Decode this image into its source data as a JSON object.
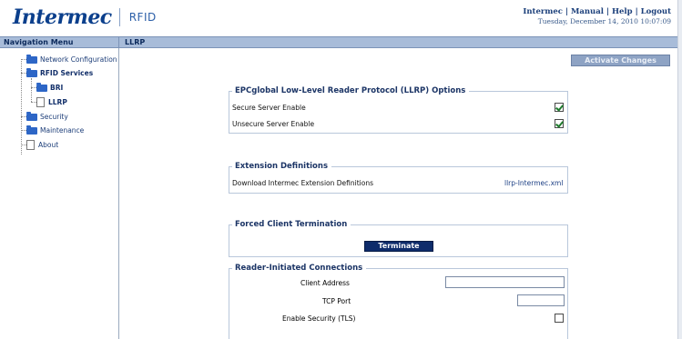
{
  "header": {
    "brand": "Intermec",
    "product": "RFID",
    "links": [
      "Intermec",
      "Manual",
      "Help",
      "Logout"
    ],
    "link_separator": " | ",
    "datetime": "Tuesday, December 14, 2010 10:07:09"
  },
  "nav": {
    "title": "Navigation Menu",
    "items": [
      {
        "label": "Network Configuration",
        "icon": "folder-icon"
      },
      {
        "label": "RFID Services",
        "icon": "folder-icon"
      },
      {
        "label": "BRI",
        "icon": "folder-icon"
      },
      {
        "label": "LLRP",
        "icon": "page-icon"
      },
      {
        "label": "Security",
        "icon": "folder-icon"
      },
      {
        "label": "Maintenance",
        "icon": "folder-icon"
      },
      {
        "label": "About",
        "icon": "page-icon"
      }
    ]
  },
  "page": {
    "title": "LLRP",
    "activate_label": "Activate Changes"
  },
  "llrp_options": {
    "legend": "EPCglobal Low-Level Reader Protocol (LLRP) Options",
    "secure_label": "Secure Server Enable",
    "secure_checked": true,
    "unsecure_label": "Unsecure Server Enable",
    "unsecure_checked": true
  },
  "extensions": {
    "legend": "Extension Definitions",
    "download_label": "Download Intermec Extension Definitions",
    "file_link": "llrp-Intermec.xml"
  },
  "forced": {
    "legend": "Forced Client Termination",
    "button_label": "Terminate"
  },
  "reader_initiated": {
    "legend": "Reader-Initiated Connections",
    "client_address_label": "Client Address",
    "client_address_value": "",
    "tcp_port_label": "TCP Port",
    "tcp_port_value": "",
    "security_label": "Enable Security (TLS)",
    "security_checked": false
  },
  "colors": {
    "accent": "#0e2c6b",
    "bar": "#a8bcd9",
    "folder": "#2d66c6"
  }
}
